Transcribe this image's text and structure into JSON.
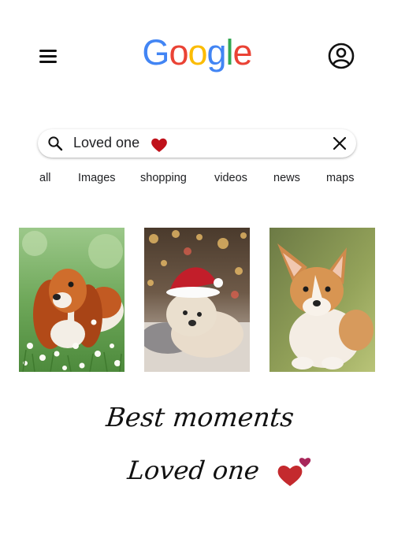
{
  "header": {
    "menu_icon": "hamburger-menu-icon",
    "logo_text": "Google",
    "logo_letters": [
      "G",
      "o",
      "o",
      "g",
      "l",
      "e"
    ],
    "logo_colors": [
      "#4285F4",
      "#EA4335",
      "#FBBC05",
      "#4285F4",
      "#34A853",
      "#EA4335"
    ],
    "account_icon": "account-circle-icon"
  },
  "search": {
    "query": "Loved one",
    "search_icon": "magnifier-icon",
    "heart_icon": "red-heart-icon",
    "clear_icon": "close-x-icon",
    "heart_color": "#C0111A"
  },
  "tabs": [
    {
      "label": "all"
    },
    {
      "label": "Images"
    },
    {
      "label": "shopping"
    },
    {
      "label": "videos"
    },
    {
      "label": "news"
    },
    {
      "label": "maps"
    }
  ],
  "results": [
    {
      "subject": "cavalier-spaniel-puppy-in-grass-photo"
    },
    {
      "subject": "poodle-puppy-in-santa-hat-photo"
    },
    {
      "subject": "corgi-puppy-photo"
    }
  ],
  "caption": {
    "line1": "Best moments",
    "line2": "Loved one",
    "hearts_icon": "two-hearts-icon",
    "heart_colors": [
      "#C42A2E",
      "#A8275A"
    ]
  }
}
